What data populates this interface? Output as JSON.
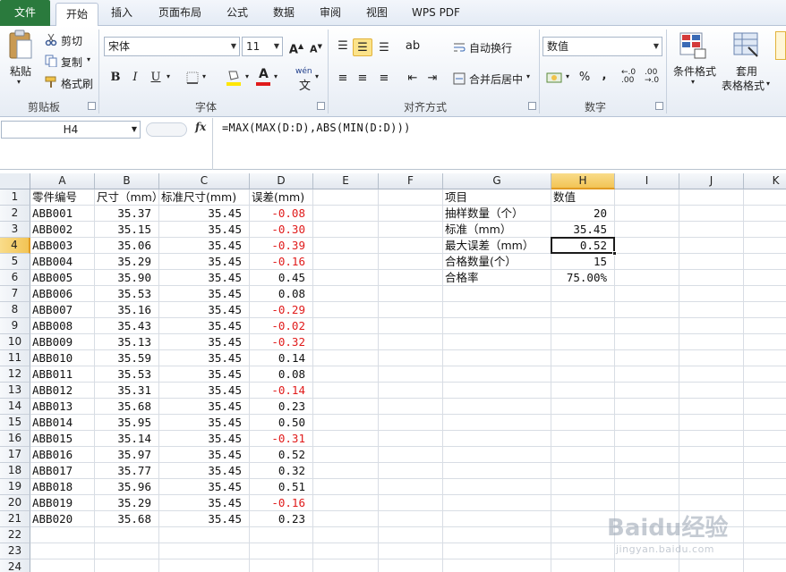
{
  "tabs": [
    {
      "label": "文件"
    },
    {
      "label": "开始"
    },
    {
      "label": "插入"
    },
    {
      "label": "页面布局"
    },
    {
      "label": "公式"
    },
    {
      "label": "数据"
    },
    {
      "label": "审阅"
    },
    {
      "label": "视图"
    },
    {
      "label": "WPS PDF"
    }
  ],
  "ribbon": {
    "clipboard": {
      "paste": "粘贴",
      "cut": "剪切",
      "copy": "复制",
      "format_painter": "格式刷",
      "group_label": "剪贴板"
    },
    "font": {
      "name": "宋体",
      "size": "11",
      "bold": "B",
      "italic": "I",
      "underline": "U",
      "group_label": "字体",
      "grow": "A",
      "shrink": "A",
      "wen": "wén",
      "font_color_letter": "A"
    },
    "alignment": {
      "wrap": "自动换行",
      "merge": "合并后居中",
      "group_label": "对齐方式"
    },
    "number": {
      "format": "数值",
      "percent": "%",
      "comma": ",",
      "inc_dec": ".00",
      "dec_dec": ".0",
      "group_label": "数字"
    },
    "styles": {
      "conditional": "条件格式",
      "table_line1": "套用",
      "table_line2": "表格格式"
    }
  },
  "formula_bar": {
    "name_box": "H4",
    "fx": "fx",
    "formula": "=MAX(MAX(D:D),ABS(MIN(D:D)))"
  },
  "columns": [
    "A",
    "B",
    "C",
    "D",
    "E",
    "F",
    "G",
    "H",
    "I",
    "J",
    "K"
  ],
  "rows": [
    "1",
    "2",
    "3",
    "4",
    "5",
    "6",
    "7",
    "8",
    "9",
    "10",
    "11",
    "12",
    "13",
    "14",
    "15",
    "16",
    "17",
    "18",
    "19",
    "20",
    "21",
    "22",
    "23",
    "24"
  ],
  "headers": {
    "a": "零件编号",
    "b": "尺寸（mm）",
    "c": "标准尺寸(mm)",
    "d": "误差(mm)"
  },
  "data_rows": [
    {
      "a": "ABB001",
      "b": "35.37",
      "c": "35.45",
      "d": "-0.08",
      "neg": true
    },
    {
      "a": "ABB002",
      "b": "35.15",
      "c": "35.45",
      "d": "-0.30",
      "neg": true
    },
    {
      "a": "ABB003",
      "b": "35.06",
      "c": "35.45",
      "d": "-0.39",
      "neg": true
    },
    {
      "a": "ABB004",
      "b": "35.29",
      "c": "35.45",
      "d": "-0.16",
      "neg": true
    },
    {
      "a": "ABB005",
      "b": "35.90",
      "c": "35.45",
      "d": "0.45",
      "neg": false
    },
    {
      "a": "ABB006",
      "b": "35.53",
      "c": "35.45",
      "d": "0.08",
      "neg": false
    },
    {
      "a": "ABB007",
      "b": "35.16",
      "c": "35.45",
      "d": "-0.29",
      "neg": true
    },
    {
      "a": "ABB008",
      "b": "35.43",
      "c": "35.45",
      "d": "-0.02",
      "neg": true
    },
    {
      "a": "ABB009",
      "b": "35.13",
      "c": "35.45",
      "d": "-0.32",
      "neg": true
    },
    {
      "a": "ABB010",
      "b": "35.59",
      "c": "35.45",
      "d": "0.14",
      "neg": false
    },
    {
      "a": "ABB011",
      "b": "35.53",
      "c": "35.45",
      "d": "0.08",
      "neg": false
    },
    {
      "a": "ABB012",
      "b": "35.31",
      "c": "35.45",
      "d": "-0.14",
      "neg": true
    },
    {
      "a": "ABB013",
      "b": "35.68",
      "c": "35.45",
      "d": "0.23",
      "neg": false
    },
    {
      "a": "ABB014",
      "b": "35.95",
      "c": "35.45",
      "d": "0.50",
      "neg": false
    },
    {
      "a": "ABB015",
      "b": "35.14",
      "c": "35.45",
      "d": "-0.31",
      "neg": true
    },
    {
      "a": "ABB016",
      "b": "35.97",
      "c": "35.45",
      "d": "0.52",
      "neg": false
    },
    {
      "a": "ABB017",
      "b": "35.77",
      "c": "35.45",
      "d": "0.32",
      "neg": false
    },
    {
      "a": "ABB018",
      "b": "35.96",
      "c": "35.45",
      "d": "0.51",
      "neg": false
    },
    {
      "a": "ABB019",
      "b": "35.29",
      "c": "35.45",
      "d": "-0.16",
      "neg": true
    },
    {
      "a": "ABB020",
      "b": "35.68",
      "c": "35.45",
      "d": "0.23",
      "neg": false
    }
  ],
  "summary": {
    "g_header": "项目",
    "h_header": "数值",
    "items": [
      {
        "g": "抽样数量（个）",
        "h": "20"
      },
      {
        "g": "标准（mm）",
        "h": "35.45"
      },
      {
        "g": "最大误差（mm）",
        "h": "0.52"
      },
      {
        "g": "合格数量(个）",
        "h": "15"
      },
      {
        "g": "合格率",
        "h": "75.00%"
      }
    ]
  },
  "selection": {
    "cell": "H4"
  },
  "colors": {
    "negative": "#e01b1b",
    "file_tab": "#2a7a3d",
    "selected_header": "#f2c455"
  },
  "watermark": {
    "text": "Baidu经验",
    "sub": "jingyan.baidu.com"
  }
}
